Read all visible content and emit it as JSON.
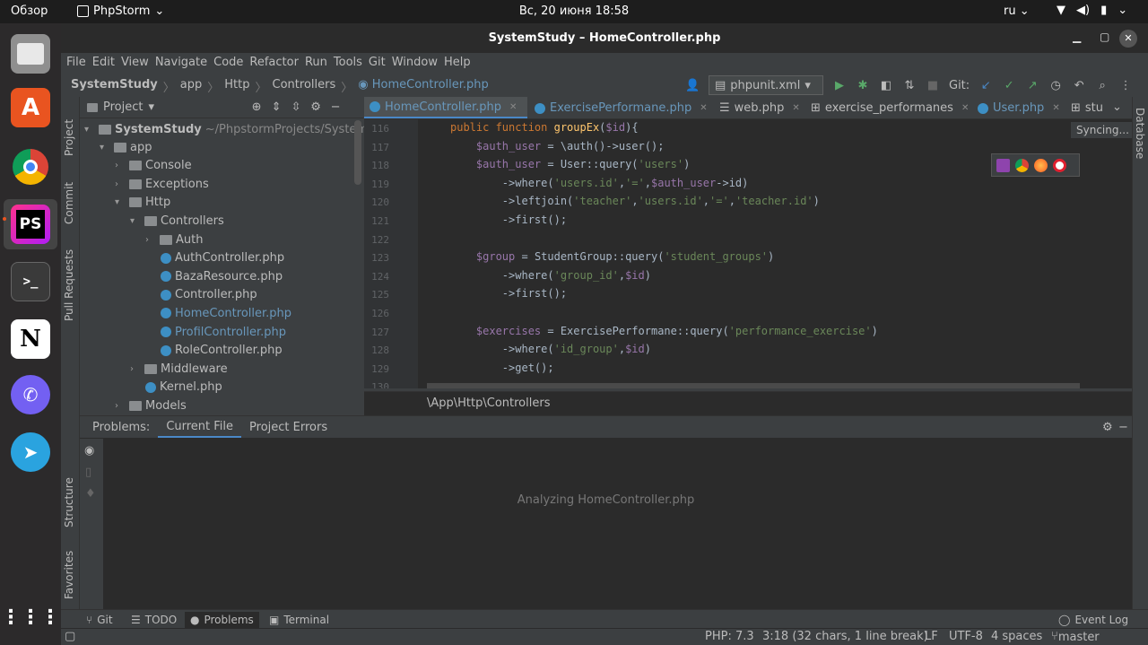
{
  "system": {
    "overview": "Обзор",
    "app_name": "PhpStorm",
    "clock": "Вс, 20 июня  18:58",
    "lang": "ru"
  },
  "window": {
    "title": "SystemStudy – HomeController.php"
  },
  "menu": [
    "File",
    "Edit",
    "View",
    "Navigate",
    "Code",
    "Refactor",
    "Run",
    "Tools",
    "Git",
    "Window",
    "Help"
  ],
  "breadcrumb": {
    "project": "SystemStudy",
    "items": [
      "app",
      "Http",
      "Controllers"
    ],
    "file": "HomeController.php"
  },
  "toolbar": {
    "run_config": "phpunit.xml",
    "git_label": "Git:"
  },
  "project_panel": {
    "title": "Project",
    "root": "SystemStudy",
    "root_path": "~/PhpstormProjects/System",
    "tree": [
      {
        "label": "app",
        "kind": "folder",
        "depth": 1,
        "open": true
      },
      {
        "label": "Console",
        "kind": "folder",
        "depth": 2
      },
      {
        "label": "Exceptions",
        "kind": "folder",
        "depth": 2
      },
      {
        "label": "Http",
        "kind": "folder",
        "depth": 2,
        "open": true
      },
      {
        "label": "Controllers",
        "kind": "folder",
        "depth": 3,
        "open": true
      },
      {
        "label": "Auth",
        "kind": "folder",
        "depth": 4
      },
      {
        "label": "AuthController.php",
        "kind": "file",
        "depth": 5
      },
      {
        "label": "BazaResource.php",
        "kind": "file",
        "depth": 5
      },
      {
        "label": "Controller.php",
        "kind": "file",
        "depth": 5
      },
      {
        "label": "HomeController.php",
        "kind": "file",
        "depth": 5,
        "modified": true
      },
      {
        "label": "ProfilController.php",
        "kind": "file",
        "depth": 5,
        "modified": true
      },
      {
        "label": "RoleController.php",
        "kind": "file",
        "depth": 5
      },
      {
        "label": "Middleware",
        "kind": "folder",
        "depth": 3
      },
      {
        "label": "Kernel.php",
        "kind": "file",
        "depth": 4
      },
      {
        "label": "Models",
        "kind": "folder",
        "depth": 2
      }
    ]
  },
  "editor_tabs": [
    {
      "label": "HomeController.php",
      "active": true
    },
    {
      "label": "ExercisePerformane.php"
    },
    {
      "label": "web.php"
    },
    {
      "label": "exercise_performanes"
    },
    {
      "label": "User.php"
    },
    {
      "label": "stu"
    }
  ],
  "editor": {
    "lines": [
      {
        "n": "116",
        "html": "<span class='kw'>public function </span><span class='fn'>groupEx</span>(<span class='var'>$id</span>){"
      },
      {
        "n": "117",
        "html": "    <span class='var'>$auth_user</span> = \\auth()-&gt;user();"
      },
      {
        "n": "118",
        "html": "    <span class='var'>$auth_user</span> = User::query(<span class='str'>'users'</span>)"
      },
      {
        "n": "119",
        "html": "        -&gt;where(<span class='str'>'users.id'</span>,<span class='str'>'='</span>,<span class='var'>$auth_user</span>-&gt;id)"
      },
      {
        "n": "120",
        "html": "        -&gt;leftjoin(<span class='str'>'teacher'</span>,<span class='str'>'users.id'</span>,<span class='str'>'='</span>,<span class='str'>'teacher.id'</span>)"
      },
      {
        "n": "121",
        "html": "        -&gt;first();"
      },
      {
        "n": "122",
        "html": ""
      },
      {
        "n": "123",
        "html": "    <span class='var'>$group</span> = StudentGroup::query(<span class='str'>'student_groups'</span>)"
      },
      {
        "n": "124",
        "html": "        -&gt;where(<span class='str'>'group_id'</span>,<span class='var'>$id</span>)"
      },
      {
        "n": "125",
        "html": "        -&gt;first();"
      },
      {
        "n": "126",
        "html": ""
      },
      {
        "n": "127",
        "html": "    <span class='var'>$exercises</span> = ExercisePerformane::query(<span class='str'>'performance_exercise'</span>)"
      },
      {
        "n": "128",
        "html": "        -&gt;where(<span class='str'>'id_group'</span>,<span class='var'>$id</span>)"
      },
      {
        "n": "129",
        "html": "        -&gt;get();"
      },
      {
        "n": "130",
        "html": ""
      }
    ],
    "namespace_crumb": "\\App\\Http\\Controllers",
    "syncing": "Syncing..."
  },
  "problems": {
    "label": "Problems:",
    "tabs": [
      "Current File",
      "Project Errors"
    ],
    "status": "Analyzing HomeController.php"
  },
  "left_strip": [
    "Project",
    "Commit",
    "Pull Requests",
    "Structure",
    "Favorites"
  ],
  "right_strip": [
    "Database"
  ],
  "bottom_tabs": [
    "Git",
    "TODO",
    "Problems",
    "Terminal"
  ],
  "event_log": "Event Log",
  "status": {
    "php": "PHP: 7.3",
    "position": "3:18 (32 chars, 1 line break)",
    "line_sep": "LF",
    "encoding": "UTF-8",
    "indent": "4 spaces",
    "branch": "master"
  }
}
